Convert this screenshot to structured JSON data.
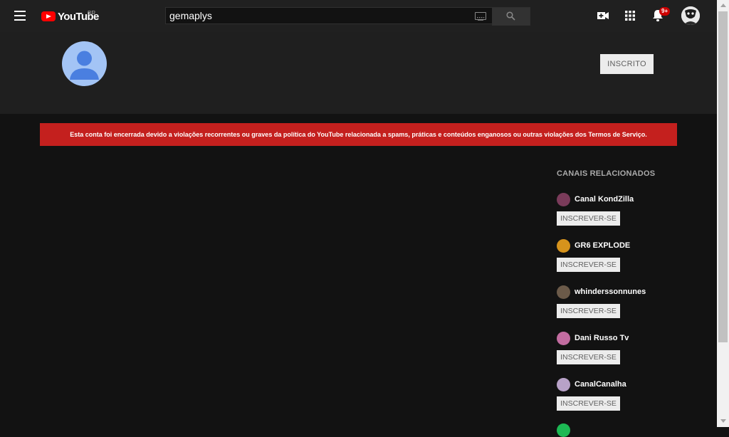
{
  "header": {
    "logo_text": "YouTube",
    "region": "BR",
    "search_value": "gemaplys",
    "notification_count": "9+"
  },
  "channel": {
    "subscribe_state_label": "INSCRITO"
  },
  "alert": {
    "message": "Esta conta foi encerrada devido a violações recorrentes ou graves da política do YouTube relacionada a spams, práticas e conteúdos enganosos ou outras violações dos Termos de Serviço.",
    "color": "#c4201e"
  },
  "related": {
    "title": "CANAIS RELACIONADOS",
    "channels": [
      {
        "name": "Canal KondZilla",
        "button": "INSCREVER-SE",
        "avatar_color": "#7a3b5a"
      },
      {
        "name": "GR6 EXPLODE",
        "button": "INSCREVER-SE",
        "avatar_color": "#d6931c"
      },
      {
        "name": "whinderssonnunes",
        "button": "INSCREVER-SE",
        "avatar_color": "#6b5a49"
      },
      {
        "name": "Dani Russo Tv",
        "button": "INSCREVER-SE",
        "avatar_color": "#c26ca0"
      },
      {
        "name": "CanalCanalha",
        "button": "INSCREVER-SE",
        "avatar_color": "#b8a2c8"
      }
    ]
  },
  "icons": [
    "menu-icon",
    "youtube-logo-icon",
    "keyboard-icon",
    "search-icon",
    "create-video-icon",
    "apps-grid-icon",
    "bell-icon",
    "user-avatar-icon",
    "default-channel-avatar-icon"
  ]
}
